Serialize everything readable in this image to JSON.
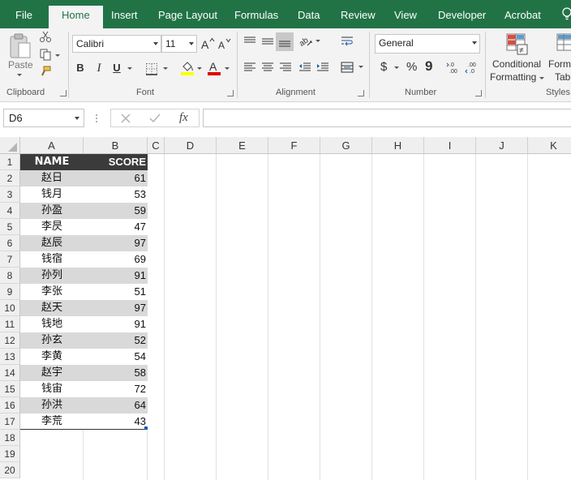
{
  "tabs": [
    "File",
    "Home",
    "Insert",
    "Page Layout",
    "Formulas",
    "Data",
    "Review",
    "View",
    "Developer",
    "Acrobat"
  ],
  "active_tab": "Home",
  "ribbon": {
    "clipboard": {
      "label": "Clipboard",
      "paste_label": "Paste"
    },
    "font": {
      "label": "Font",
      "font_name": "Calibri",
      "font_size": "11",
      "bold": "B",
      "italic": "I",
      "underline": "U"
    },
    "alignment": {
      "label": "Alignment"
    },
    "number": {
      "label": "Number",
      "format": "General",
      "currency": "$",
      "percent": "%",
      "comma": "9"
    },
    "styles": {
      "label": "Styles",
      "conditional_formatting_line1": "Conditional",
      "conditional_formatting_line2": "Formatting",
      "format_table_line1": "Form",
      "format_table_line2": "Tab"
    }
  },
  "formula_bar": {
    "name_box": "D6",
    "fx": "fx",
    "formula": ""
  },
  "columns": [
    "A",
    "B",
    "C",
    "D",
    "E",
    "F",
    "G",
    "H",
    "I",
    "J",
    "K"
  ],
  "rows": [
    "1",
    "2",
    "3",
    "4",
    "5",
    "6",
    "7",
    "8",
    "9",
    "10",
    "11",
    "12",
    "13",
    "14",
    "15",
    "16",
    "17",
    "18",
    "19",
    "20"
  ],
  "table": {
    "headers": [
      "NAME",
      "SCORE"
    ],
    "data": [
      [
        "赵日",
        "61"
      ],
      [
        "钱月",
        "53"
      ],
      [
        "孙盈",
        "59"
      ],
      [
        "李昃",
        "47"
      ],
      [
        "赵辰",
        "97"
      ],
      [
        "钱宿",
        "69"
      ],
      [
        "孙列",
        "91"
      ],
      [
        "李张",
        "51"
      ],
      [
        "赵天",
        "97"
      ],
      [
        "钱地",
        "91"
      ],
      [
        "孙玄",
        "52"
      ],
      [
        "李黄",
        "54"
      ],
      [
        "赵宇",
        "58"
      ],
      [
        "钱宙",
        "72"
      ],
      [
        "孙洪",
        "64"
      ],
      [
        "李荒",
        "43"
      ]
    ]
  },
  "colors": {
    "excel_green": "#217346",
    "header_fill": "#3b3b3b",
    "band_fill": "#d9d9d9"
  }
}
